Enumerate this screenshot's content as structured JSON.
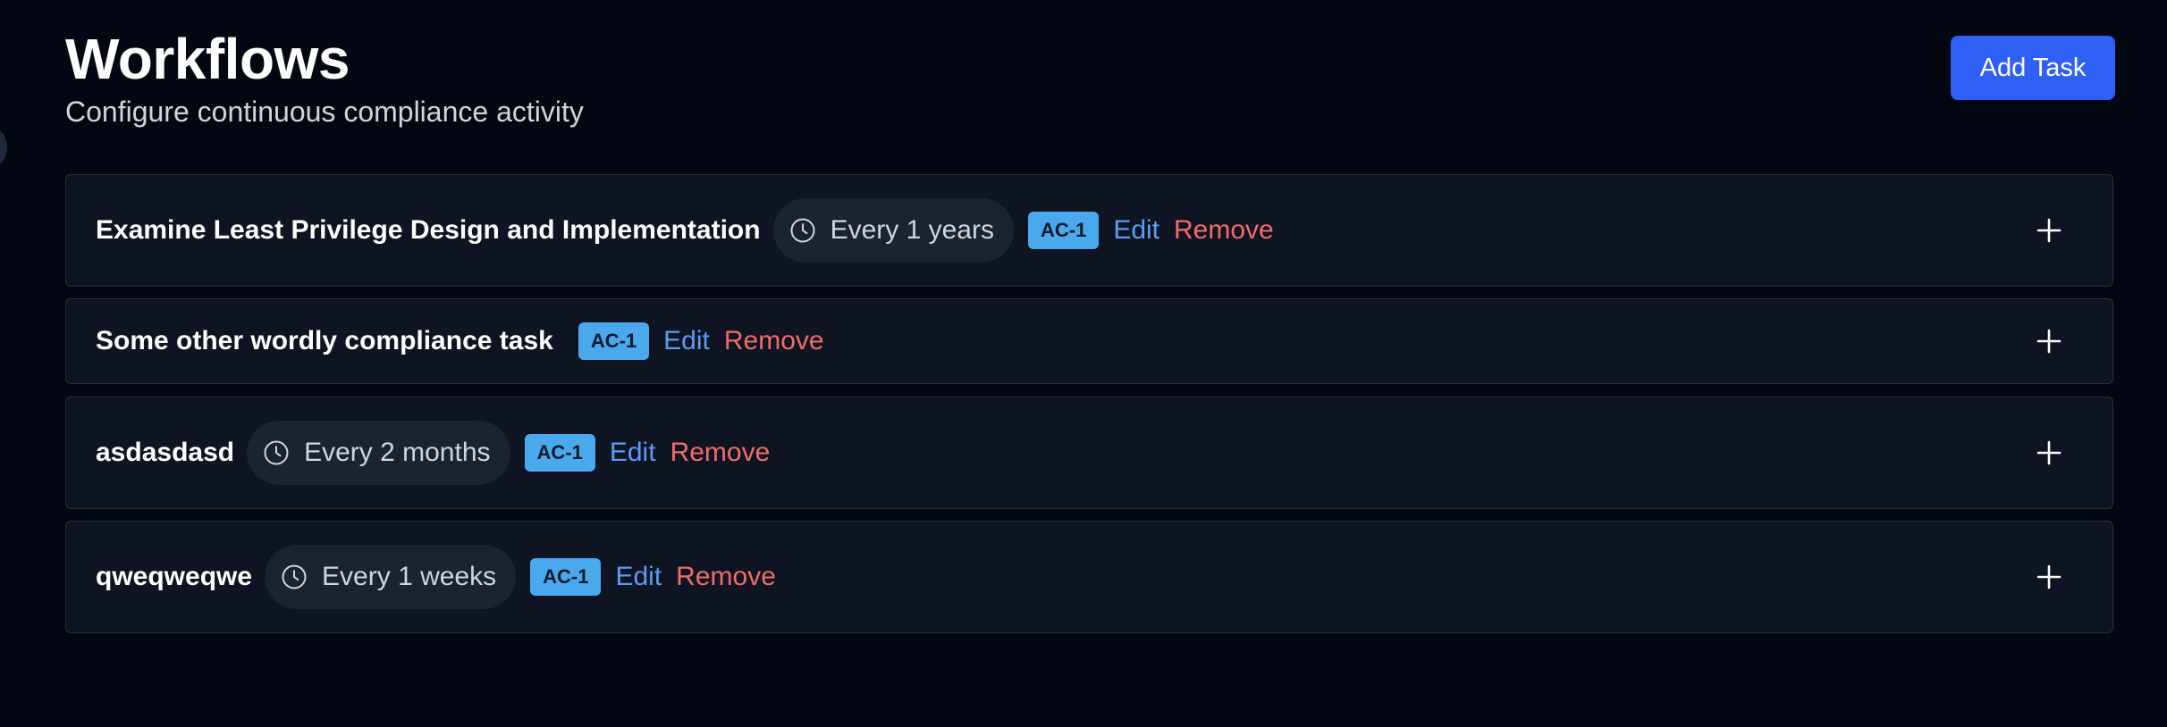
{
  "header": {
    "title": "Workflows",
    "subtitle": "Configure continuous compliance activity",
    "add_task_label": "Add Task"
  },
  "tasks": [
    {
      "title": "Examine Least Privilege Design and Implementation",
      "schedule": "Every 1 years",
      "control": "AC-1",
      "edit_label": "Edit",
      "remove_label": "Remove"
    },
    {
      "title": "Some other wordly compliance task",
      "schedule": "",
      "control": "AC-1",
      "edit_label": "Edit",
      "remove_label": "Remove"
    },
    {
      "title": "asdasdasd",
      "schedule": "Every 2 months",
      "control": "AC-1",
      "edit_label": "Edit",
      "remove_label": "Remove"
    },
    {
      "title": "qweqweqwe",
      "schedule": "Every 1 weeks",
      "control": "AC-1",
      "edit_label": "Edit",
      "remove_label": "Remove"
    }
  ],
  "icons": {
    "schedule": "clock-icon",
    "expand": "plus-icon"
  },
  "colors": {
    "background": "#030712",
    "card": "#0e1421",
    "primary_button": "#2f5ff5",
    "badge": "#4aa9ec",
    "edit": "#5b9cf5",
    "remove": "#f16b6b"
  }
}
